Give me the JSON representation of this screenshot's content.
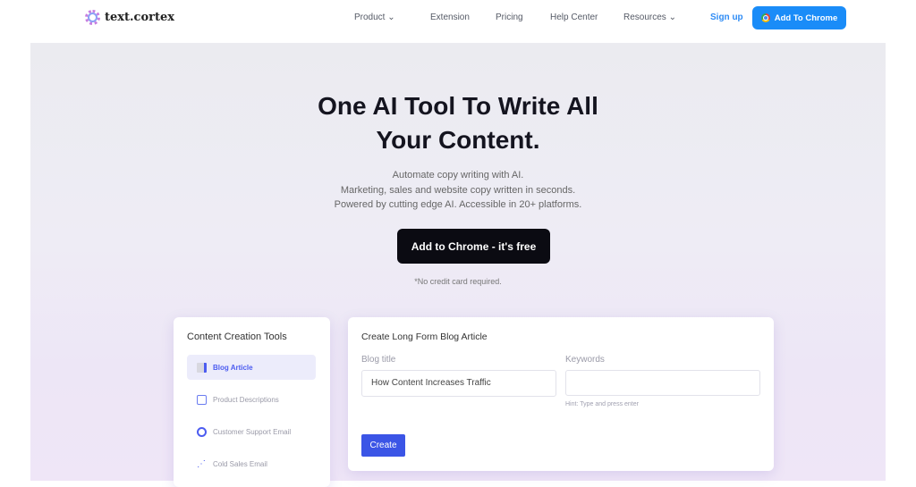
{
  "nav": {
    "logo": "text.cortex",
    "items": [
      {
        "label": "Product",
        "dropdown": true
      },
      {
        "label": "Extension"
      },
      {
        "label": "Pricing"
      },
      {
        "label": "Help Center"
      },
      {
        "label": "Resources",
        "dropdown": true
      }
    ],
    "sign_up": "Sign up",
    "add_to_chrome": "Add To Chrome"
  },
  "hero": {
    "title_line1": "One AI Tool To Write All",
    "title_line2": "Your Content.",
    "sub1": "Automate copy writing with AI.",
    "sub2": "Marketing, sales and website copy written in seconds.",
    "sub3": "Powered by cutting edge AI. Accessible in 20+ platforms.",
    "cta": "Add to Chrome - it's free",
    "note": "*No credit card required."
  },
  "tools": {
    "title": "Content Creation Tools",
    "items": [
      {
        "label": "Blog Article",
        "icon": "document-icon",
        "active": true
      },
      {
        "label": "Product Descriptions",
        "icon": "box-icon"
      },
      {
        "label": "Customer Support Email",
        "icon": "lifebuoy-icon"
      },
      {
        "label": "Cold Sales Email",
        "icon": "chart-line-icon"
      }
    ]
  },
  "form": {
    "title": "Create Long Form Blog Article",
    "blog_title_label": "Blog title",
    "blog_title_value": "How Content Increases Traffic",
    "keywords_label": "Keywords",
    "keywords_value": "",
    "hint": "Hint: Type and press enter",
    "create": "Create"
  },
  "colors": {
    "accent": "#1a8cf8",
    "create": "#3b55e6",
    "active_tool": "#4c5cf0"
  }
}
